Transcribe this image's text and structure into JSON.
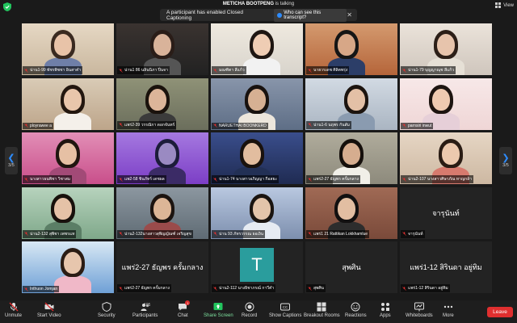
{
  "topbar": {
    "speaker_name": "METICHA BOOTPENG",
    "speaker_suffix": "is talking",
    "view_label": "View"
  },
  "cc_banner": {
    "message": "A participant has enabled Closed Captioning",
    "link_label": "Who can see this transcript?",
    "close_glyph": "✕"
  },
  "pager": {
    "left_page": "3/5",
    "right_page": "3/5",
    "left_arrow": "❮",
    "right_arrow": "❯"
  },
  "tiles": [
    {
      "name": "น่าน1-99 พัชรพิชชา อินสาคำ",
      "center_text": "",
      "row": 0,
      "col": 0
    },
    {
      "name": "น่าน1 86 นลินนิภา ปิ่นจา",
      "center_text": "",
      "row": 0,
      "col": 1
    },
    {
      "name": "มณฑิตา สีแก้ว",
      "center_text": "",
      "row": 0,
      "col": 2
    },
    {
      "name": "นายวรเดช ศิลิตพรุ่ง",
      "center_text": "",
      "row": 0,
      "col": 3
    },
    {
      "name": "น่าน1-79 บุญญาณุช สีแก้ว",
      "center_text": "",
      "row": 0,
      "col": 4
    },
    {
      "name": "ployrawee a",
      "center_text": "",
      "row": 1,
      "col": 0
    },
    {
      "name": "แพร่2-39 วรรณิกา ดอกจันทร์",
      "center_text": "",
      "row": 1,
      "col": 1
    },
    {
      "name": "NARUETHAI BOONKERD",
      "center_text": "",
      "row": 1,
      "col": 2
    },
    {
      "name": "น่าน1-6 นฤพร กันสัม",
      "center_text": "",
      "row": 1,
      "col": 3
    },
    {
      "name": "parnsiri inwut",
      "center_text": "",
      "row": 1,
      "col": 4
    },
    {
      "name": "นางสาวธนพิชา วิชาสม",
      "center_text": "",
      "row": 2,
      "col": 0
    },
    {
      "name": "แพ2-58 ชินภัทร์ เดชผล",
      "center_text": "",
      "row": 2,
      "col": 1
    },
    {
      "name": "น่าน1-74 นางสาวอภิญญา กีอสยะ",
      "center_text": "",
      "row": 2,
      "col": 2
    },
    {
      "name": "แพร่2-27 ธัญพร ครั้มกลาง",
      "center_text": "",
      "row": 2,
      "col": 3
    },
    {
      "name": "น่าน2-107 นางสาวศิษาภัณ หาญกล้า",
      "center_text": "",
      "row": 2,
      "col": 4
    },
    {
      "name": "น่าน2-132 สุพิชา เพชรแท",
      "center_text": "",
      "row": 3,
      "col": 0
    },
    {
      "name": "น่าน2-132นางสาวสุพิญญัณฑ์ เจริญสุข",
      "center_text": "",
      "row": 3,
      "col": 1
    },
    {
      "name": "น่าน 93 ภัทรวรรณ ธอเงิน",
      "center_text": "",
      "row": 3,
      "col": 2
    },
    {
      "name": "แพร่1 21 Rattikan Lokkhamlue",
      "center_text": "",
      "row": 3,
      "col": 3
    },
    {
      "name": "จารุนันท์",
      "center_text": "จารุนันท์",
      "row": 3,
      "col": 4
    },
    {
      "name": "Inthuon Jomjan",
      "center_text": "",
      "row": 4,
      "col": 0
    },
    {
      "name": "แพร่2-27 ธัญพร ครั้มกลาง",
      "center_text": "แพร่2-27 ธัญพร ครั้มกลาง",
      "row": 4,
      "col": 1
    },
    {
      "name": "น่าน2-112 นางธิชาภรณ์ กาวีคำ",
      "center_text": "T",
      "row": 4,
      "col": 2
    },
    {
      "name": "สุพศิน",
      "center_text": "สุพศิน",
      "row": 4,
      "col": 3
    },
    {
      "name": "แพร่1-12 สิรินดา อยู่ทิม",
      "center_text": "แพร่1-12 สิรินดา อยู่ทิม",
      "row": 4,
      "col": 4
    }
  ],
  "toolbar": {
    "unmute": "Unmute",
    "start_video": "Start Video",
    "security": "Security",
    "participants": "Participants",
    "participants_count": "105",
    "chat": "Chat",
    "chat_badge": "1",
    "share_screen": "Share Screen",
    "record": "Record",
    "show_captions": "Show Captions",
    "breakout_rooms": "Breakout Rooms",
    "reactions": "Reactions",
    "apps": "Apps",
    "whiteboards": "Whiteboards",
    "more": "More",
    "leave": "Leave"
  },
  "colors": {
    "accent_blue": "#2d8cff",
    "leave_red": "#e02f2f",
    "share_green": "#22c55e",
    "avatar_teal": "#2a9d9d"
  }
}
